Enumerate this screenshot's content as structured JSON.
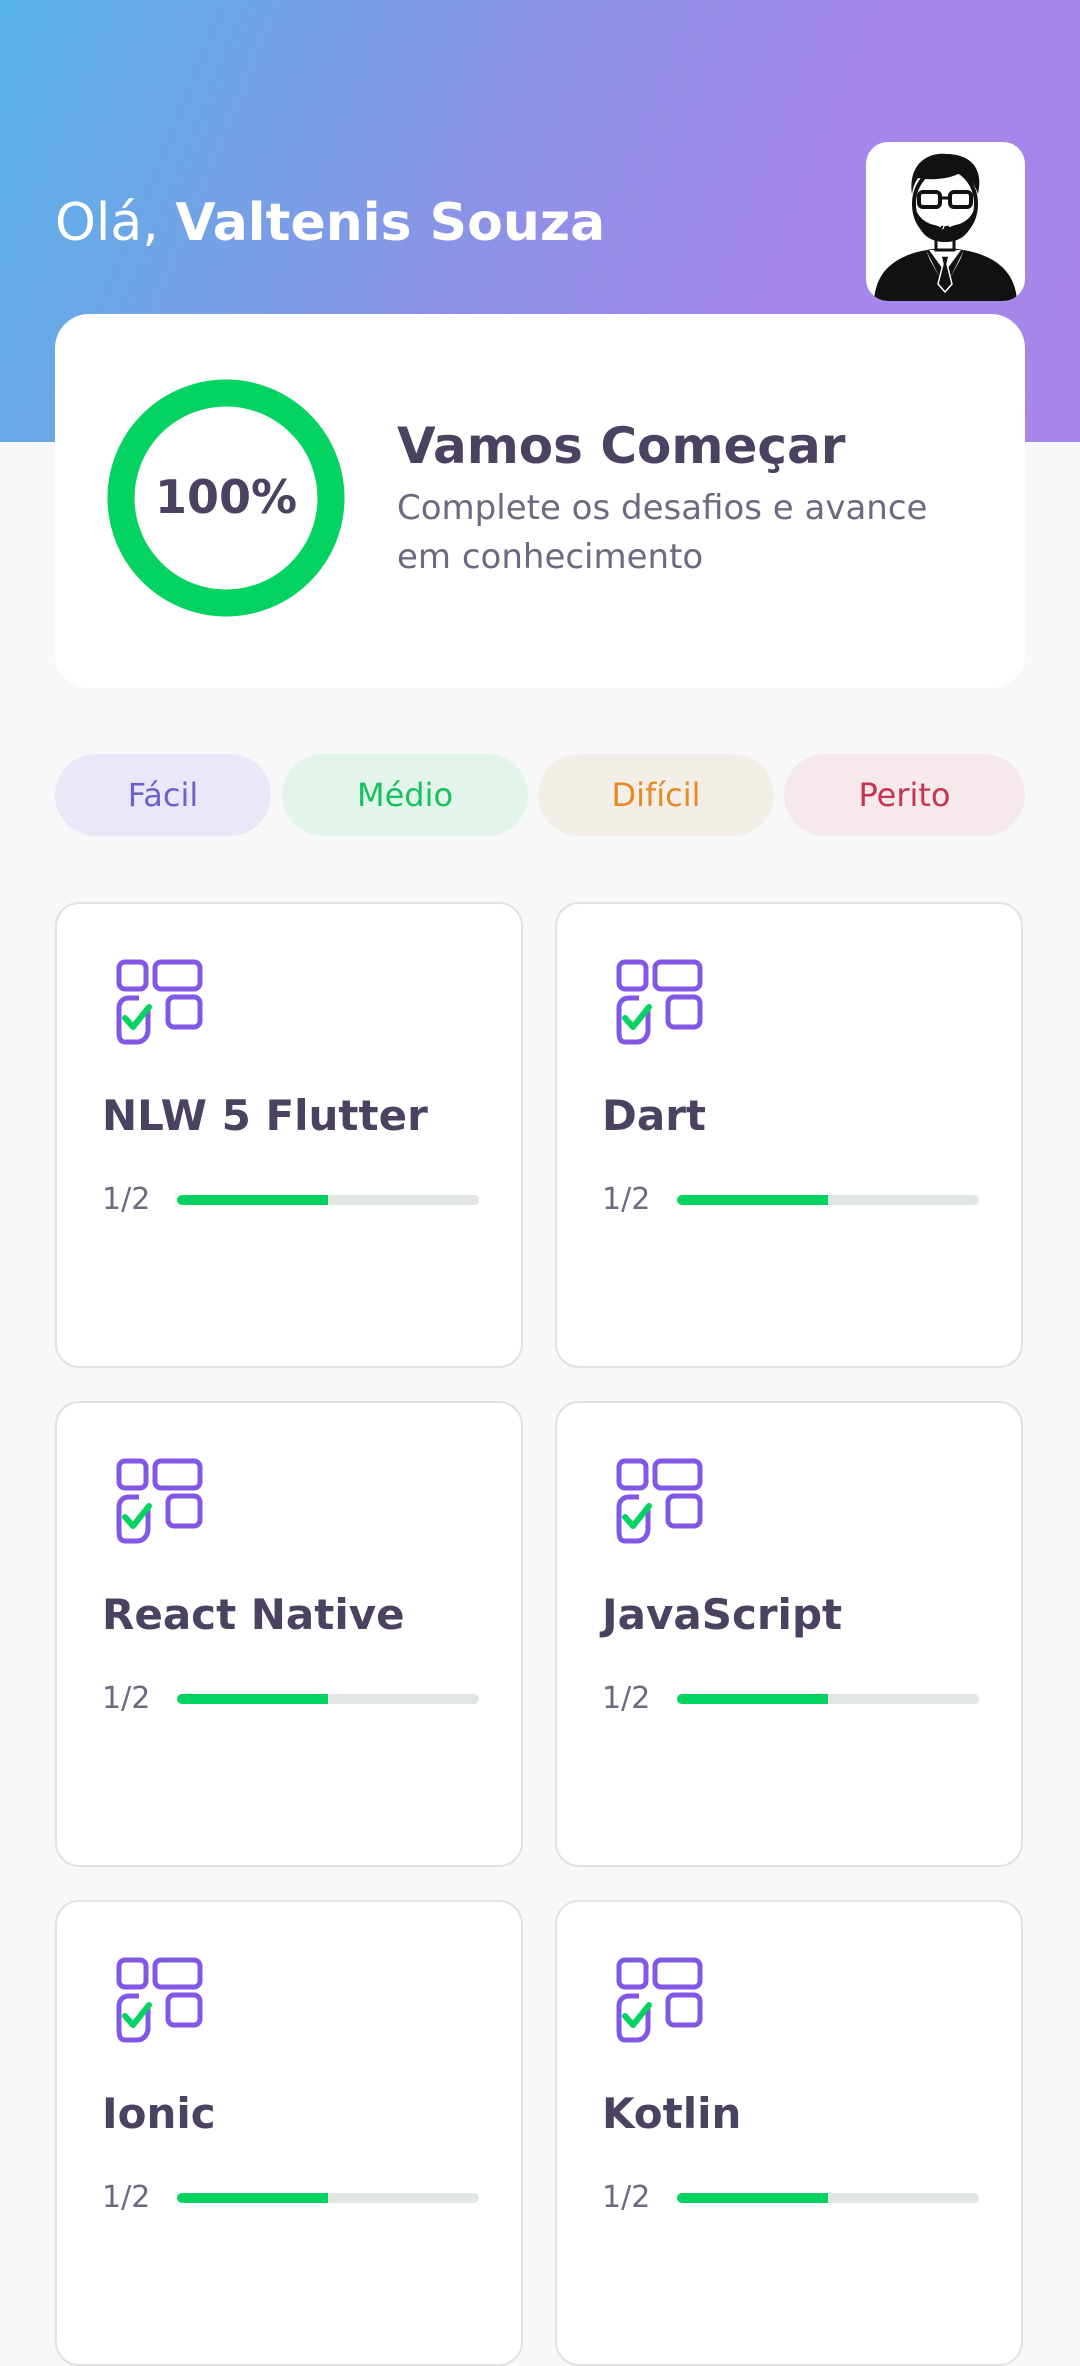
{
  "header": {
    "greeting": "Olá,",
    "user_name": "Valtenis Souza"
  },
  "score_card": {
    "percent_label": "100%",
    "percent_value": 1.0,
    "title": "Vamos Começar",
    "subtitle": "Complete os desafios e avance em conhecimento"
  },
  "levels": [
    {
      "label": "Fácil",
      "text_color": "#6C62C9",
      "bg_color": "#E9E7F8"
    },
    {
      "label": "Médio",
      "text_color": "#17C25E",
      "bg_color": "#E3F5EB"
    },
    {
      "label": "Difícil",
      "text_color": "#E68A24",
      "bg_color": "#F3EEE7"
    },
    {
      "label": "Perito",
      "text_color": "#C8334E",
      "bg_color": "#F5E9EB"
    }
  ],
  "quizzes": [
    {
      "title": "NLW 5 Flutter",
      "count_label": "1/2",
      "progress": 0.5
    },
    {
      "title": "Dart",
      "count_label": "1/2",
      "progress": 0.5
    },
    {
      "title": "React Native",
      "count_label": "1/2",
      "progress": 0.5
    },
    {
      "title": "JavaScript",
      "count_label": "1/2",
      "progress": 0.5
    },
    {
      "title": "Ionic",
      "count_label": "1/2",
      "progress": 0.5
    },
    {
      "title": "Kotlin",
      "count_label": "1/2",
      "progress": 0.5
    }
  ],
  "icons": {
    "avatar": "developer-avatar-icon",
    "quiz": "blocks-check-icon"
  },
  "colors": {
    "accent_purple": "#8257E5",
    "accent_green": "#04D361",
    "text_dark": "#4A4260",
    "text_grey": "#6E6980"
  }
}
